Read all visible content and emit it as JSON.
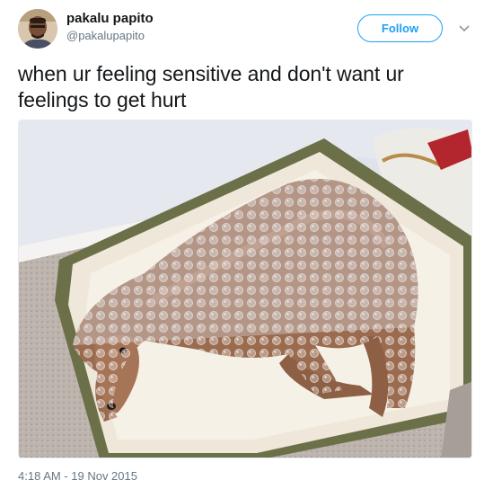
{
  "author": {
    "display_name": "pakalu papito",
    "handle": "@pakalupapito"
  },
  "follow_button": {
    "label": "Follow"
  },
  "tweet": {
    "text": "when ur feeling sensitive and don't want ur feelings to get hurt",
    "timestamp": "4:18 AM - 19 Nov 2015"
  },
  "icons": {
    "menu": "chevron-down-icon",
    "avatar": "profile-photo"
  },
  "colors": {
    "accent": "#1da1f2",
    "secondary_text": "#657786",
    "primary_text": "#14171a"
  }
}
